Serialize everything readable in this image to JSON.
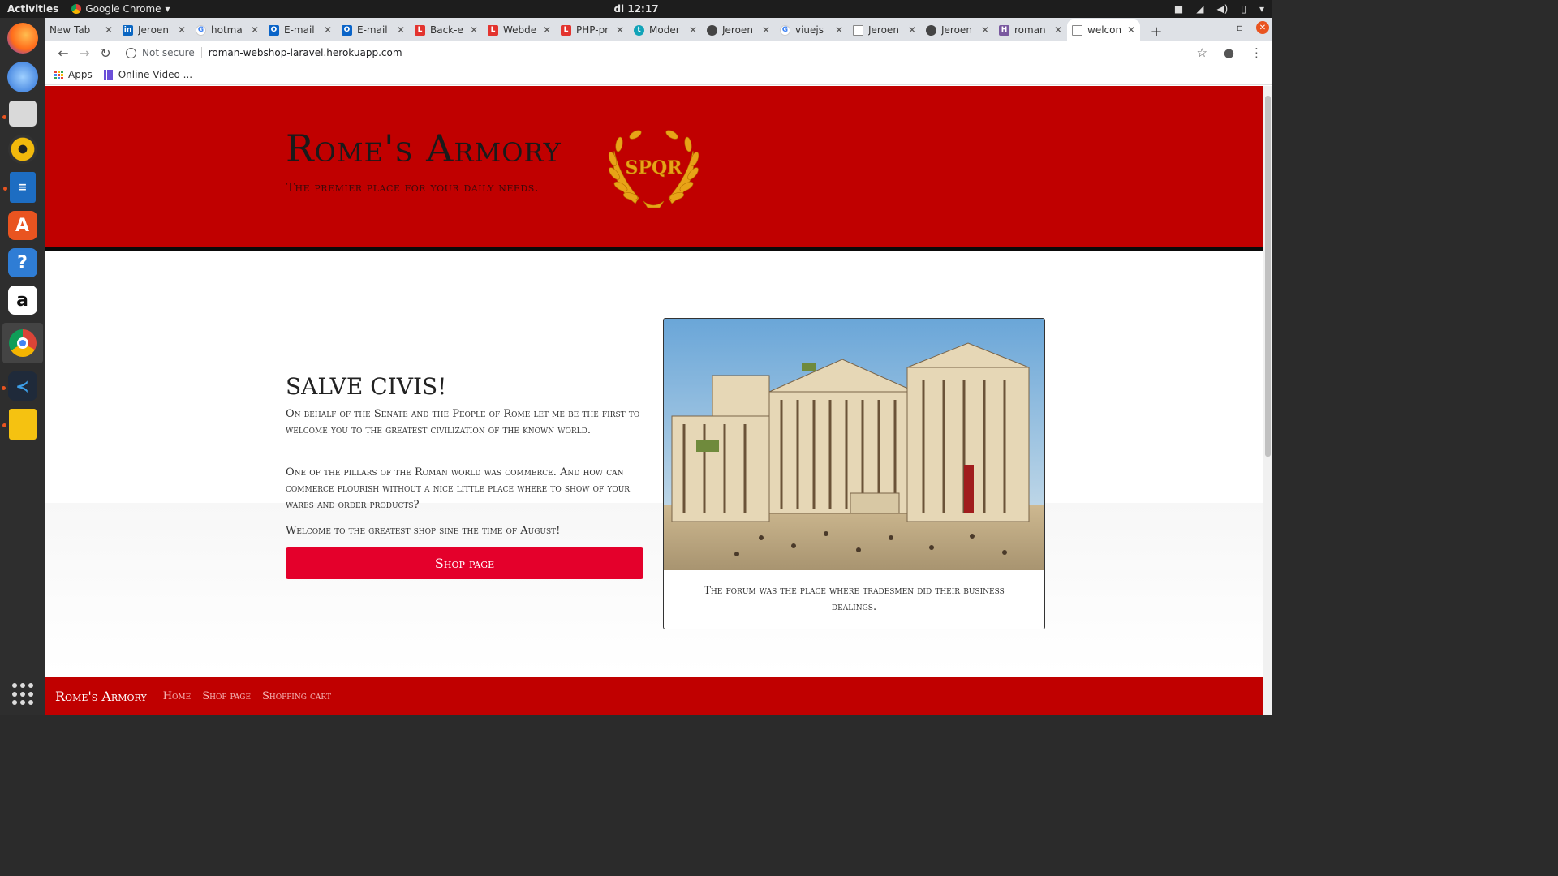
{
  "system": {
    "activities": "Activities",
    "app_name": "Google Chrome",
    "clock": "di 12:17"
  },
  "tabs": [
    {
      "label": "New Tab",
      "icon": "none"
    },
    {
      "label": "Jeroen",
      "icon": "linkedin-icon"
    },
    {
      "label": "hotma",
      "icon": "google-icon"
    },
    {
      "label": "E-mail",
      "icon": "outlook-icon"
    },
    {
      "label": "E-mail",
      "icon": "outlook-icon"
    },
    {
      "label": "Back-e",
      "icon": "laravel-icon"
    },
    {
      "label": "Webde",
      "icon": "laravel-icon"
    },
    {
      "label": "PHP-pr",
      "icon": "laravel-icon"
    },
    {
      "label": "Moder",
      "icon": "teal-t-icon"
    },
    {
      "label": "Jeroen",
      "icon": "github-icon"
    },
    {
      "label": "viuejs",
      "icon": "google-icon"
    },
    {
      "label": "Jeroen",
      "icon": "page-icon"
    },
    {
      "label": "Jeroen",
      "icon": "github-icon"
    },
    {
      "label": "roman",
      "icon": "heroku-icon"
    },
    {
      "label": "welcon",
      "icon": "page-icon",
      "active": true
    }
  ],
  "address_bar": {
    "security": "Not secure",
    "url": "roman-webshop-laravel.herokuapp.com"
  },
  "bookmarks": [
    {
      "label": "Apps"
    },
    {
      "label": "Online Video ..."
    }
  ],
  "page": {
    "site_title": "Rome's Armory",
    "tagline": "The premier place for your daily needs.",
    "emblem_text": "SPQR",
    "greeting": "SALVE CIVIS!",
    "paragraphs": [
      "On behalf of the Senate and the People of Rome let me be the first to welcome you to the greatest civilization of the known world.",
      "One of the pillars of the Roman world was commerce. And how can commerce flourish without a nice little place where to show of your wares and order products?",
      "Welcome to the greatest shop sine the time of August!"
    ],
    "shop_button": "Shop page",
    "image_caption": "The forum was the place where tradesmen did their business dealings.",
    "footer": {
      "brand": "Rome's Armory",
      "links": [
        "Home",
        "Shop page",
        "Shopping cart"
      ]
    }
  },
  "colors": {
    "hero_red": "#c00000",
    "button_red": "#e4002b",
    "emblem_gold": "#e8a317"
  }
}
